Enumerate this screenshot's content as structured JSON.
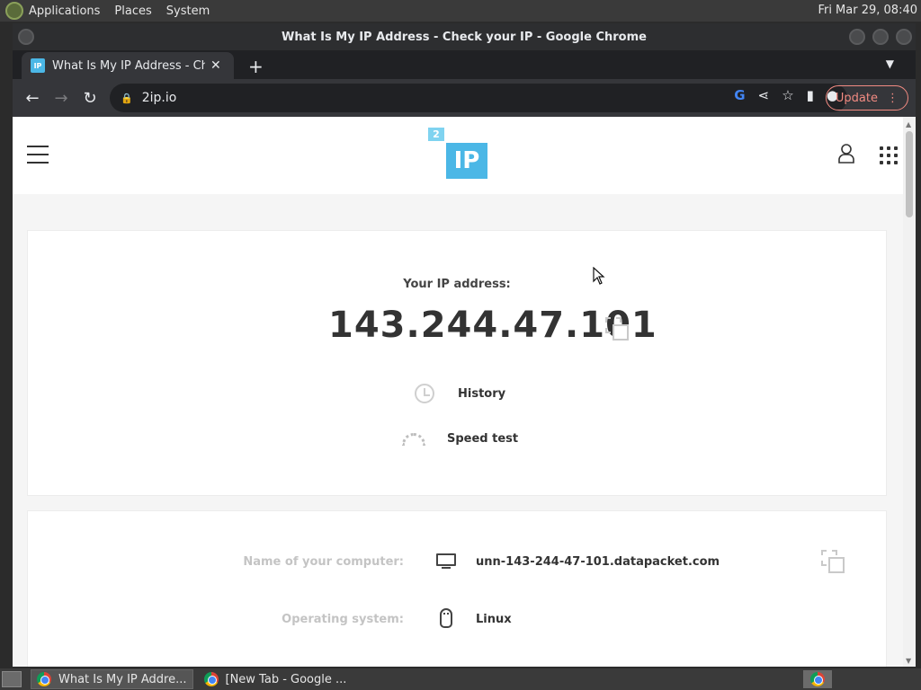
{
  "top_panel": {
    "menus": [
      "Applications",
      "Places",
      "System"
    ],
    "clock": "Fri Mar 29, 08:40"
  },
  "window": {
    "title": "What Is My IP Address - Check your IP - Google Chrome"
  },
  "tab": {
    "favicon_text": "IP",
    "title": "What Is My IP Address - Check your IP"
  },
  "toolbar": {
    "url": "2ip.io",
    "update_label": "Update"
  },
  "site": {
    "logo_small": "2",
    "logo_main": "IP",
    "ip_label": "Your IP address:",
    "ip_value": "143.244.47.101",
    "history_label": "History",
    "speed_test_label": "Speed test",
    "details": [
      {
        "label": "Name of your computer:",
        "value": "unn-143-244-47-101.datapacket.com",
        "icon": "monitor-icon"
      },
      {
        "label": "Operating system:",
        "value": "Linux",
        "icon": "linux-penguin-icon"
      }
    ]
  },
  "taskbar": {
    "items": [
      "What Is My IP Addre...",
      "[New Tab - Google ..."
    ]
  }
}
